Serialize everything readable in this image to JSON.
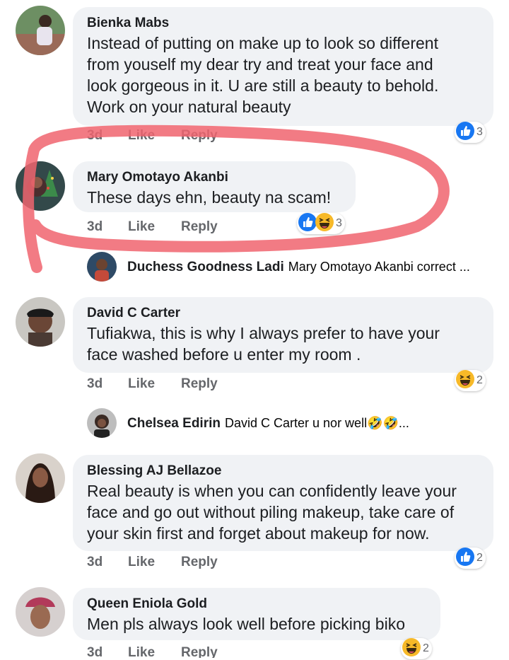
{
  "comments": [
    {
      "author": "Bienka Mabs",
      "text": "Instead of putting on make up to look so different\nfrom youself my dear try and treat your face and\nlook gorgeous in it. U are still a beauty to behold.\nWork on your natural beauty",
      "time": "3d",
      "like": "Like",
      "reply": "Reply",
      "reactions": [
        "like"
      ],
      "reaction_count": "3"
    },
    {
      "author": "Mary Omotayo Akanbi",
      "text": "These days ehn, beauty na scam!",
      "time": "3d",
      "like": "Like",
      "reply": "Reply",
      "reactions": [
        "like",
        "haha"
      ],
      "reaction_count": "3"
    },
    {
      "author": "David C Carter",
      "text": "Tufiakwa, this is why I always prefer to have your\nface washed before u enter my room .",
      "time": "3d",
      "like": "Like",
      "reply": "Reply",
      "reactions": [
        "haha"
      ],
      "reaction_count": "2"
    },
    {
      "author": "Blessing AJ Bellazoe",
      "text": "Real beauty is when you can confidently leave your\nface and go out without piling makeup, take care of\nyour skin first and forget about makeup for now.",
      "time": "3d",
      "like": "Like",
      "reply": "Reply",
      "reactions": [
        "like"
      ],
      "reaction_count": "2"
    },
    {
      "author": "Queen Eniola Gold",
      "text": "Men pls always look well before picking biko",
      "time": "3d",
      "like": "Like",
      "reply": "Reply",
      "reactions": [
        "haha"
      ],
      "reaction_count": "2"
    }
  ],
  "replies": [
    {
      "author": "Duchess Goodness Ladi",
      "preview": "Mary Omotayo Akanbi correct ..."
    },
    {
      "author": "Chelsea Edirin",
      "preview": "David C Carter u nor well",
      "emoji": "🤣🤣",
      "ellipsis": "..."
    }
  ],
  "colors": {
    "like_blue": "#1877f2",
    "haha_yellow": "#f7b928",
    "annotation_red": "#f0646e",
    "bubble": "#f0f2f5"
  }
}
